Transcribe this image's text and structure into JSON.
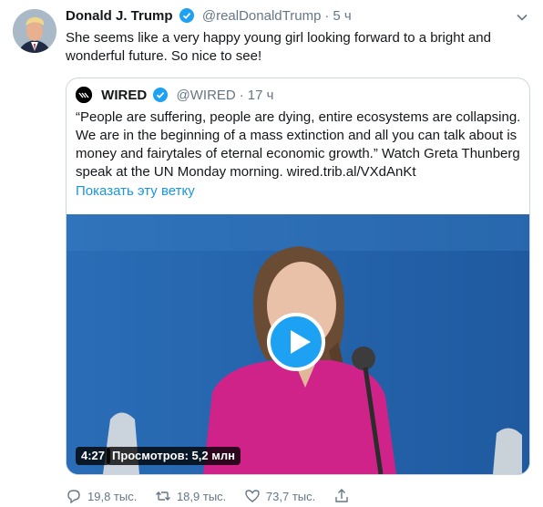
{
  "tweet": {
    "author_name": "Donald J. Trump",
    "handle": "@realDonaldTrump",
    "separator": "·",
    "time": "5 ч",
    "text": "She seems like a very happy young girl looking forward to a bright and wonderful future. So nice to see!",
    "icons": {
      "verified": "verified-badge-icon",
      "menu": "chevron-down-icon"
    }
  },
  "quoted": {
    "author_name": "WIRED",
    "handle": "@WIRED",
    "separator": "·",
    "time": "17 ч",
    "text": "“People are suffering, people are dying, entire ecosystems are collapsing. We are in the beginning of a mass extinction and all you can talk about is money and fairytales of eternal economic growth.” Watch Greta Thunberg speak at the UN Monday morning. wired.trib.al/VXdAnKt",
    "thread_link": "Показать эту ветку",
    "video": {
      "duration": "4:27",
      "views": "Просмотров: 5,2 млн",
      "icon": "play-icon"
    }
  },
  "actions": {
    "reply_count": "19,8 тыс.",
    "retweet_count": "18,9 тыс.",
    "like_count": "73,7 тыс.",
    "icons": [
      "reply-icon",
      "retweet-icon",
      "like-icon",
      "share-icon"
    ]
  },
  "colors": {
    "link": "#1b95e0",
    "verified": "#1da1f2",
    "muted": "#657786",
    "border": "#ccd6dd"
  }
}
